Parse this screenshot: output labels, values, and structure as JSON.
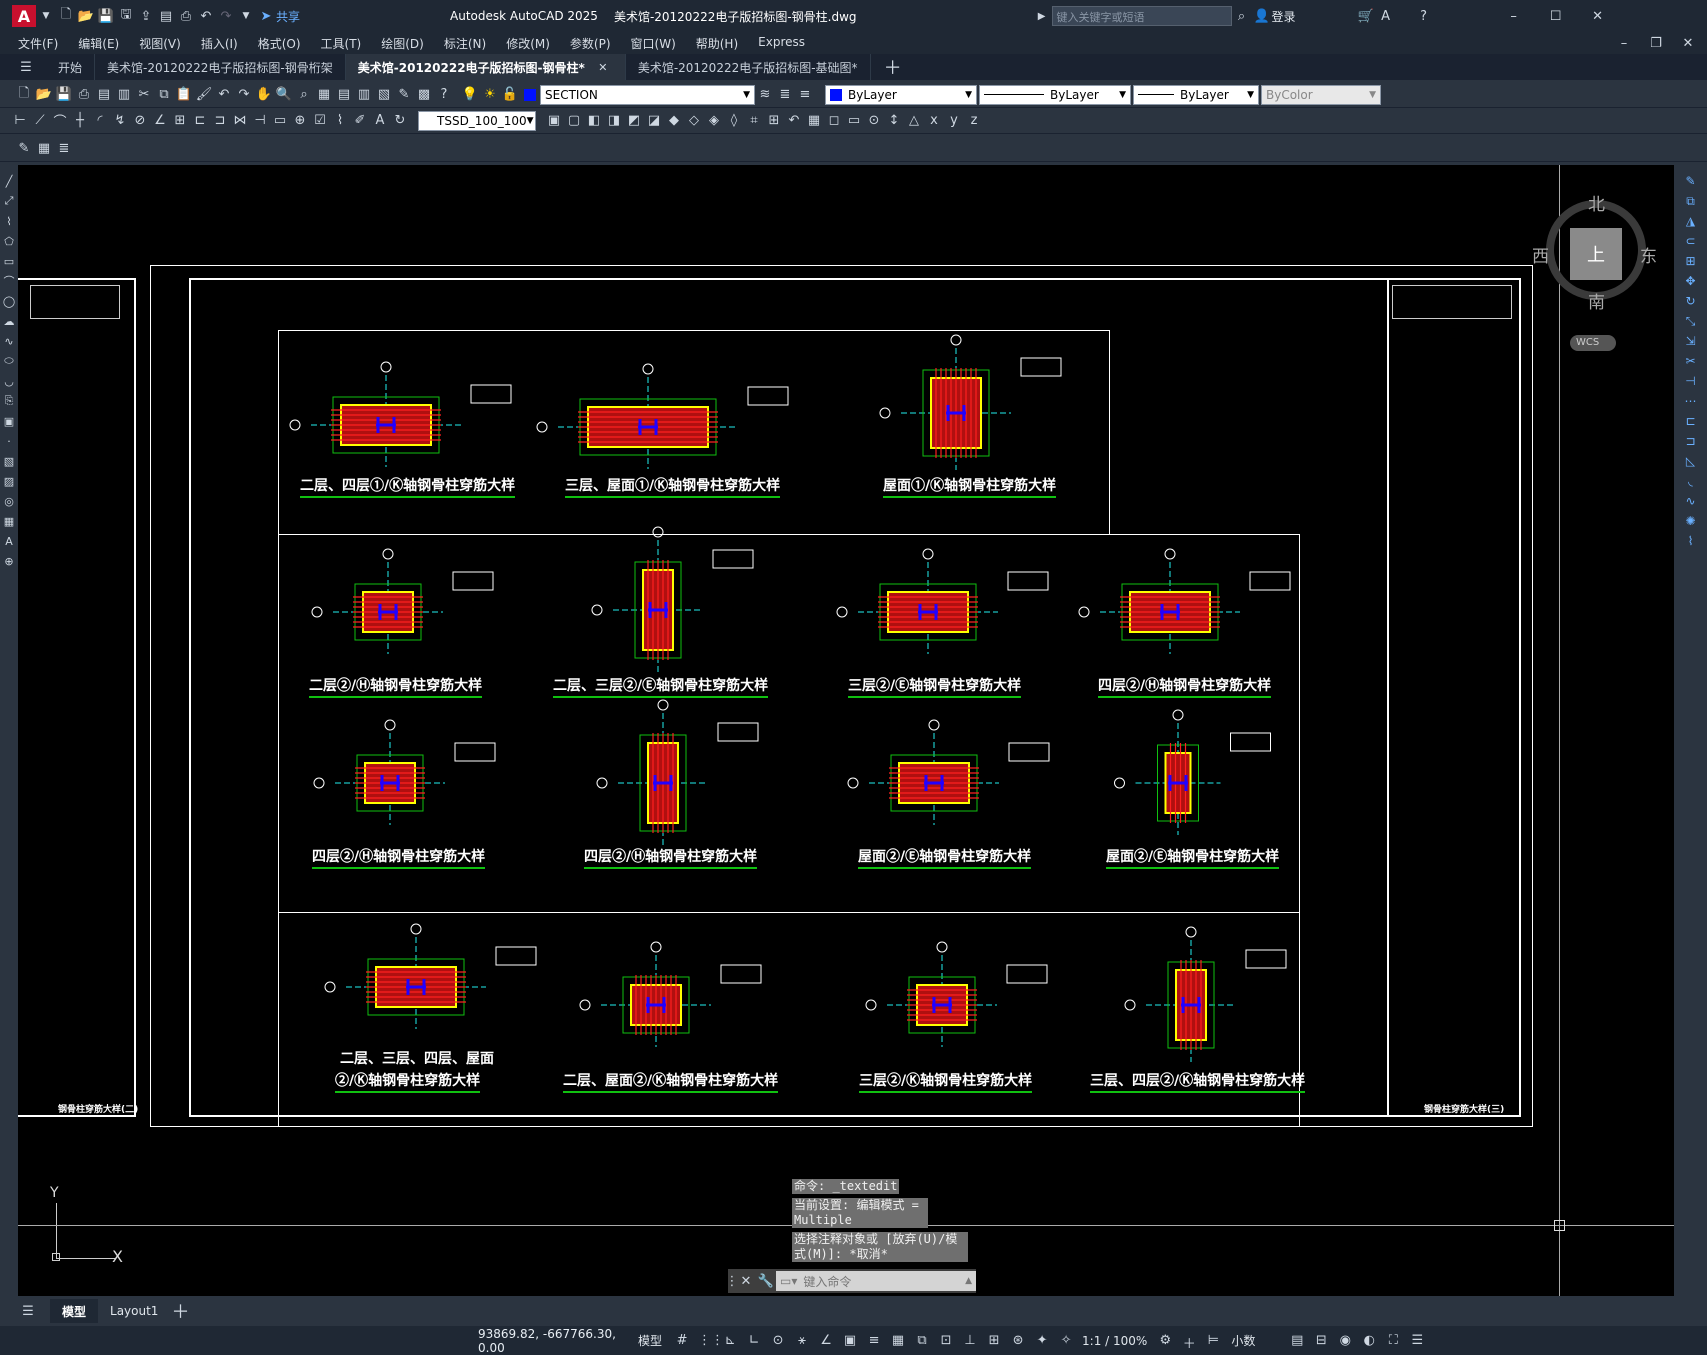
{
  "app": {
    "logo": "A",
    "title": "Autodesk AutoCAD 2025",
    "file": "美术馆-20120222电子版招标图-钢骨柱.dwg",
    "share_label": "共享",
    "search_placeholder": "键入关键字或短语",
    "login_label": "登录"
  },
  "menu": [
    "文件(F)",
    "编辑(E)",
    "视图(V)",
    "插入(I)",
    "格式(O)",
    "工具(T)",
    "绘图(D)",
    "标注(N)",
    "修改(M)",
    "参数(P)",
    "窗口(W)",
    "帮助(H)",
    "Express"
  ],
  "tabs": {
    "start": "开始",
    "items": [
      {
        "label": "美术馆-20120222电子版招标图-钢骨桁架",
        "active": false
      },
      {
        "label": "美术馆-20120222电子版招标图-钢骨柱*",
        "active": true
      },
      {
        "label": "美术馆-20120222电子版招标图-基础图*",
        "active": false
      }
    ]
  },
  "toolbar": {
    "layer": "SECTION",
    "color": "ByLayer",
    "linetype": "ByLayer",
    "lineweight": "ByLayer",
    "plotstyle": "ByColor",
    "dimstyle": "TSSD_100_100"
  },
  "viewcube": {
    "north": "北",
    "south": "南",
    "east": "东",
    "west": "西",
    "top": "上",
    "wcs": "WCS"
  },
  "drawing": {
    "row1": [
      "二层、四层①/Ⓚ轴钢骨柱穿筋大样",
      "三层、屋面①/Ⓚ轴钢骨柱穿筋大样",
      "屋面①/Ⓚ轴钢骨柱穿筋大样"
    ],
    "row2": [
      "二层②/Ⓗ轴钢骨柱穿筋大样",
      "二层、三层②/Ⓔ轴钢骨柱穿筋大样",
      "三层②/Ⓔ轴钢骨柱穿筋大样",
      "四层②/Ⓗ轴钢骨柱穿筋大样"
    ],
    "row3": [
      "四层②/Ⓗ轴钢骨柱穿筋大样",
      "四层②/Ⓗ轴钢骨柱穿筋大样",
      "屋面②/Ⓔ轴钢骨柱穿筋大样",
      "屋面②/Ⓔ轴钢骨柱穿筋大样"
    ],
    "row4_first_line1": "二层、三层、四层、屋面",
    "row4_first_line2": "②/Ⓚ轴钢骨柱穿筋大样",
    "row4": [
      "二层、屋面②/Ⓚ轴钢骨柱穿筋大样",
      "三层②/Ⓚ轴钢骨柱穿筋大样",
      "三层、四层②/Ⓚ轴钢骨柱穿筋大样"
    ],
    "sheet_title_left": "钢骨柱穿筋大样(二)",
    "sheet_title_right": "钢骨柱穿筋大样(三)",
    "axis_y": "Y",
    "axis_x": "X"
  },
  "command": {
    "history": [
      "命令: _textedit",
      "当前设置: 编辑模式 = Multiple",
      "选择注释对象或 [放弃(U)/模式(M)]: *取消*"
    ],
    "placeholder": "键入命令"
  },
  "layout": {
    "model": "模型",
    "layout1": "Layout1"
  },
  "status": {
    "coords": "93869.82, -667766.30, 0.00",
    "model": "模型",
    "scale": "1:1 / 100%",
    "units": "小数"
  },
  "colors": {
    "accent": "#0696d7",
    "steel": "#ffff00",
    "rebar": "#ff2020",
    "dim": "#10c010"
  }
}
